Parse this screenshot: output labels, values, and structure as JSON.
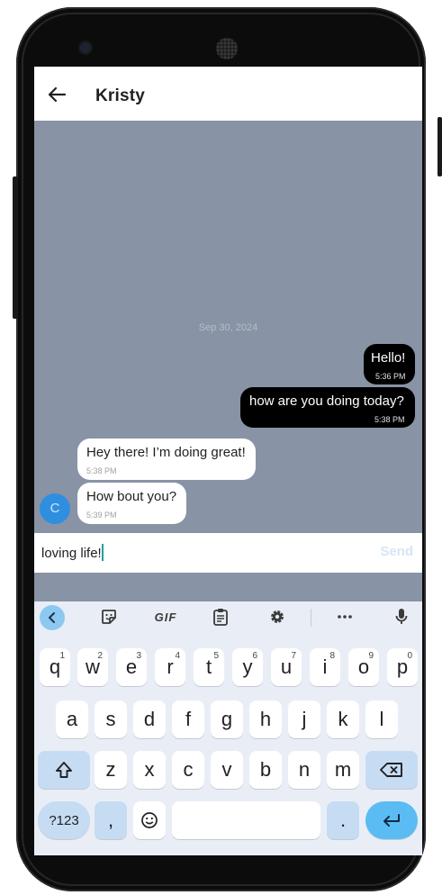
{
  "header": {
    "title": "Kristy"
  },
  "chat": {
    "date": "Sep 30, 2024",
    "avatar_letter": "C",
    "messages": [
      {
        "direction": "out",
        "text": "Hello!",
        "time": "5:36 PM"
      },
      {
        "direction": "out",
        "text": "how are you doing today?",
        "time": "5:38 PM"
      },
      {
        "direction": "in",
        "text": "Hey there! I’m doing great!",
        "time": "5:38 PM"
      },
      {
        "direction": "in",
        "text": "How bout you?",
        "time": "5:39 PM"
      }
    ]
  },
  "composer": {
    "value": "loving life!",
    "send_label": "Send"
  },
  "keyboard": {
    "toolbar": {
      "gif": "GIF"
    },
    "row1": [
      {
        "k": "q",
        "s": "1"
      },
      {
        "k": "w",
        "s": "2"
      },
      {
        "k": "e",
        "s": "3"
      },
      {
        "k": "r",
        "s": "4"
      },
      {
        "k": "t",
        "s": "5"
      },
      {
        "k": "y",
        "s": "6"
      },
      {
        "k": "u",
        "s": "7"
      },
      {
        "k": "i",
        "s": "8"
      },
      {
        "k": "o",
        "s": "9"
      },
      {
        "k": "p",
        "s": "0"
      }
    ],
    "row2": [
      "a",
      "s",
      "d",
      "f",
      "g",
      "h",
      "j",
      "k",
      "l"
    ],
    "row3": [
      "z",
      "x",
      "c",
      "v",
      "b",
      "n",
      "m"
    ],
    "num_label": "?123",
    "comma": ",",
    "period": "."
  },
  "colors": {
    "chat_bg": "#8893a5",
    "outgoing_bubble": "#000000",
    "incoming_bubble": "#ffffff",
    "avatar": "#2e8fe0",
    "send_disabled": "#d6e6f5",
    "keyboard_bg": "#e9eef6",
    "enter_key": "#5bbcf3",
    "accent_key": "#8cc8f0"
  },
  "icons": {
    "back": "arrow-left-icon",
    "collapse": "chevron-left-icon",
    "sticker": "sticker-icon",
    "clipboard": "clipboard-icon",
    "settings": "gear-icon",
    "more": "more-horiz-icon",
    "mic": "mic-icon",
    "shift": "shift-icon",
    "backspace": "backspace-icon",
    "emoji": "emoji-icon",
    "enter": "enter-icon"
  }
}
